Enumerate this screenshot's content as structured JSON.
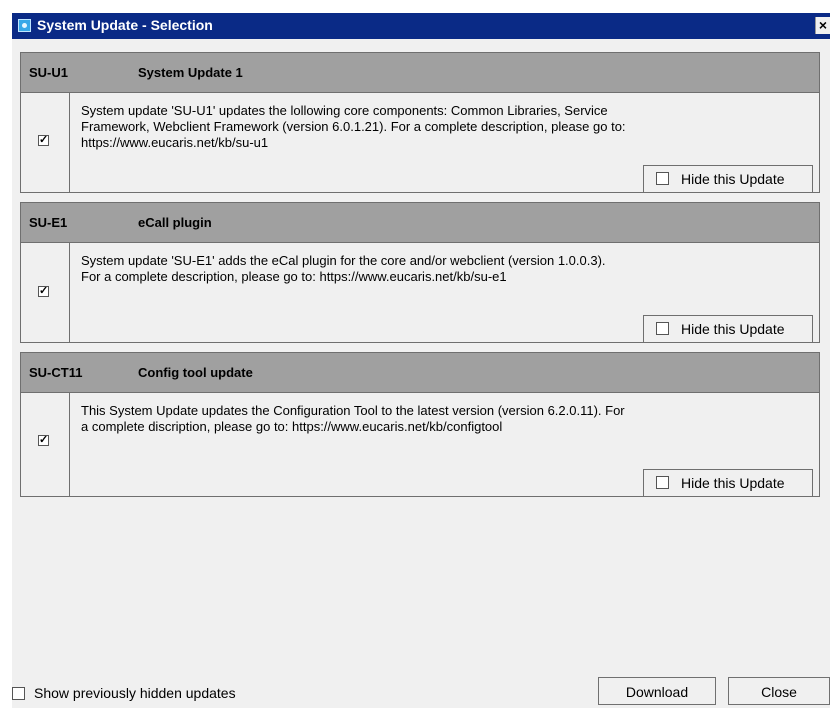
{
  "window": {
    "title": "System Update - Selection",
    "close_glyph": "×"
  },
  "updates": [
    {
      "code": "SU-U1",
      "name": "System Update 1",
      "checked": true,
      "description_lines": [
        "System update 'SU-U1' updates the lollowing core components: Common Libraries, Service",
        "Framework, Webclient Framework (version 6.0.1.21). For a complete description, please go to:",
        "https://www.eucaris.net/kb/su-u1"
      ],
      "hide_label": "Hide this Update",
      "hide_checked": false
    },
    {
      "code": "SU-E1",
      "name": "eCall plugin",
      "checked": true,
      "description_lines": [
        "System update 'SU-E1' adds the eCal plugin for the core and/or webclient (version 1.0.0.3).",
        "For a complete description, please go to: https://www.eucaris.net/kb/su-e1"
      ],
      "hide_label": "Hide this Update",
      "hide_checked": false
    },
    {
      "code": "SU-CT11",
      "name": "Config tool update",
      "checked": true,
      "description_lines": [
        "This System Update updates the Configuration Tool to the latest version (version 6.2.0.11). For",
        "a complete discription, please go to: https://www.eucaris.net/kb/configtool"
      ],
      "hide_label": "Hide this Update",
      "hide_checked": false
    }
  ],
  "footer": {
    "show_hidden_label": "Show previously hidden updates",
    "show_hidden_checked": false,
    "download_label": "Download",
    "close_label": "Close"
  },
  "colors": {
    "titlebar": "#0a2a86",
    "panel_header": "#a0a0a0",
    "client_background": "#f0f0f0"
  },
  "icons": {
    "title": "app-icon",
    "checked": "checkmark-icon"
  }
}
